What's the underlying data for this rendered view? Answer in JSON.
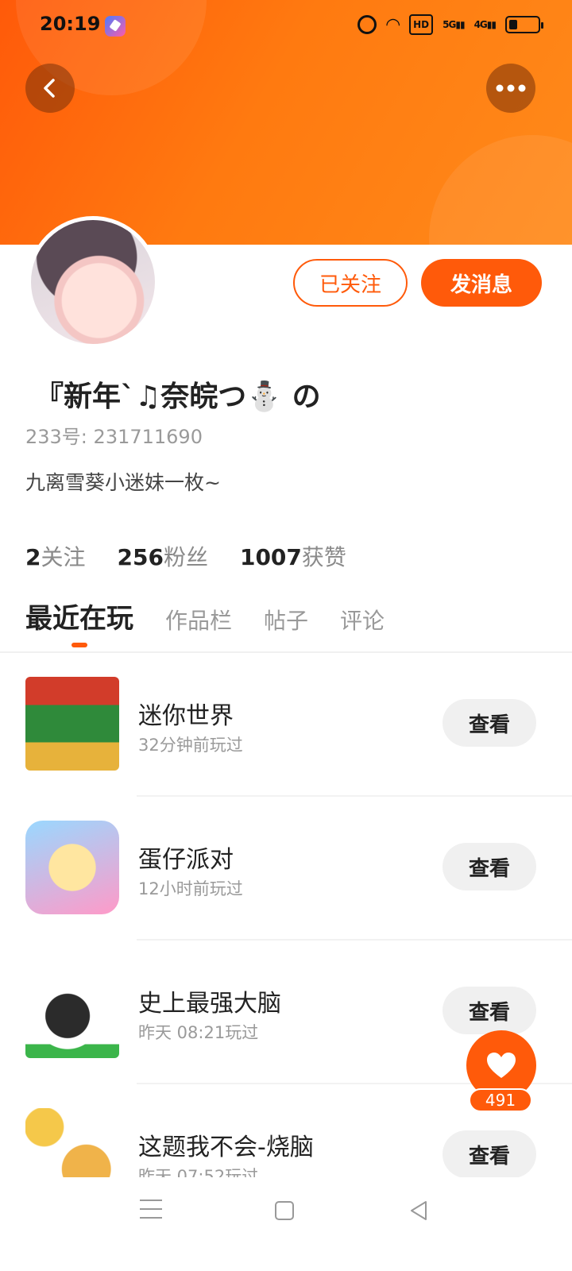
{
  "status_bar": {
    "time": "20:19",
    "network_5g": "5G",
    "network_4g": "4G",
    "hd": "HD"
  },
  "header": {
    "back_icon": "chevron-left-icon",
    "more_icon": "more-dots-icon",
    "accent_color": "#ff5a0a"
  },
  "profile": {
    "username": "『新年`♫奈皖つ⛄ の",
    "uid_label": "233号:",
    "uid_value": "231711690",
    "bio": "九离雪葵小迷妹一枚~",
    "follow_button": "已关注",
    "message_button": "发消息"
  },
  "stats": [
    {
      "num": "2",
      "label": "关注"
    },
    {
      "num": "256",
      "label": "粉丝"
    },
    {
      "num": "1007",
      "label": "获赞"
    }
  ],
  "tabs": [
    {
      "label": "最近在玩",
      "active": true
    },
    {
      "label": "作品栏",
      "active": false
    },
    {
      "label": "帖子",
      "active": false
    },
    {
      "label": "评论",
      "active": false
    }
  ],
  "games": [
    {
      "name": "迷你世界",
      "time": "32分钟前玩过",
      "action": "查看"
    },
    {
      "name": "蛋仔派对",
      "time": "12小时前玩过",
      "action": "查看"
    },
    {
      "name": "史上最强大脑",
      "time": "昨天 08:21玩过",
      "action": "查看"
    },
    {
      "name": "这题我不会-烧脑",
      "time": "昨天 07:52玩过",
      "action": "查看"
    }
  ],
  "like": {
    "icon": "heart-icon",
    "count": "491"
  },
  "nav": {
    "menu_icon": "menu-icon",
    "home_icon": "home-square-icon",
    "back_icon": "back-triangle-icon"
  }
}
